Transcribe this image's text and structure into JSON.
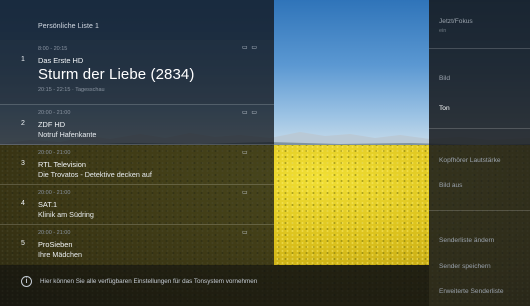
{
  "list": {
    "title": "Persönliche Liste 1",
    "items": [
      {
        "time": "8:00 - 20:15",
        "number": "1",
        "channel": "Das Erste HD",
        "program": "Sturm der Liebe (2834)",
        "sub": "20:15 - 22:15 · Tagesschau",
        "icons": "▭ ▭"
      },
      {
        "time": "20:00 - 21:00",
        "number": "2",
        "channel": "ZDF HD",
        "program": "Notruf Hafenkante",
        "sub": "",
        "icons": "▭ ▭"
      },
      {
        "time": "20:00 - 21:00",
        "number": "3",
        "channel": "RTL Television",
        "program": "Die Trovatos - Detektive decken auf",
        "sub": "",
        "icons": "▭"
      },
      {
        "time": "20:00 - 21:00",
        "number": "4",
        "channel": "SAT.1",
        "program": "Klinik am Südring",
        "sub": "",
        "icons": "▭"
      },
      {
        "time": "20:00 - 21:00",
        "number": "5",
        "channel": "ProSieben",
        "program": "Ihre Mädchen",
        "sub": "",
        "icons": "▭"
      }
    ]
  },
  "settings": {
    "items": [
      {
        "label": "Jetzt/Fokus",
        "sub": "ein"
      },
      {
        "label": "Bild",
        "sub": ""
      },
      {
        "label": "Ton",
        "sub": ""
      },
      {
        "label": "Kopfhörer Lautstärke",
        "sub": ""
      },
      {
        "label": "Bild aus",
        "sub": ""
      },
      {
        "label": "Senderliste ändern",
        "sub": ""
      },
      {
        "label": "Sender speichern",
        "sub": ""
      },
      {
        "label": "Erweiterte Senderliste",
        "sub": ""
      }
    ]
  },
  "info": {
    "icon": "info-icon",
    "text": "Hier können Sie alle verfügbaren Einstellungen für das Tonsystem vornehmen"
  },
  "colors": {
    "panel": "#0c1016",
    "sky": "#3b7fc1",
    "field": "#e0c620"
  }
}
